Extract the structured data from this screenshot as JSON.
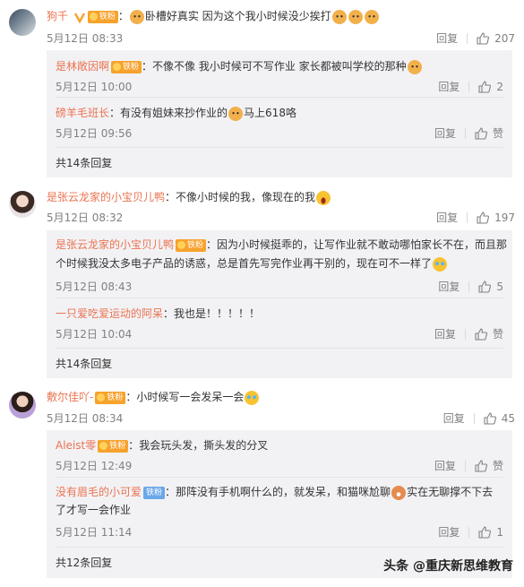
{
  "comments": [
    {
      "user": "狗千",
      "text": "卧槽好真实  因为这个我小时候没少挨打",
      "date": "5月12日 08:33",
      "reply_label": "回复",
      "likes": "207",
      "subreplies": [
        {
          "user": "是林敞因啊",
          "text": "不像不像 我小时候可不写作业 家长都被叫学校的那种",
          "date": "5月12日 10:00",
          "reply_label": "回复",
          "likes": "2"
        },
        {
          "user": "磅羊毛班长",
          "text": "有没有姐妹来抄作业的",
          "text2": "马上618咯",
          "date": "5月12日 09:56",
          "reply_label": "回复",
          "likes": "赞"
        }
      ],
      "more": "共14条回复"
    },
    {
      "user": "是张云龙家的小宝贝儿鸭",
      "text": "不像小时候的我，像现在的我",
      "date": "5月12日 08:32",
      "reply_label": "回复",
      "likes": "197",
      "subreplies": [
        {
          "user": "是张云龙家的小宝贝儿鸭",
          "text": "因为小时候挺乖的，让写作业就不敢动哪怕家长不在，而且那",
          "text_line2": "个时候我没太多电子产品的诱惑，总是首先写完作业再干别的，现在可不一样了",
          "date": "5月12日 08:43",
          "reply_label": "回复",
          "likes": "5"
        },
        {
          "user": "一只爱吃爱运动的阿呆",
          "text": "我也是！！！！！",
          "date": "5月12日 10:04",
          "reply_label": "回复",
          "likes": "赞"
        }
      ],
      "more": "共14条回复"
    },
    {
      "user": "敷尔佳吖-",
      "text": "小时候写一会发呆一会",
      "date": "5月12日 08:34",
      "reply_label": "回复",
      "likes": "45",
      "subreplies": [
        {
          "user": "Aleist零",
          "text": "我会玩头发，撕头发的分叉",
          "date": "5月12日 12:49",
          "reply_label": "回复",
          "likes": "赞"
        },
        {
          "user": "没有眉毛的小可爱",
          "text": "那阵没有手机啊什么的，就发呆，和猫咪尬聊",
          "text_tail": "实在无聊撑不下去",
          "text_line2": "了才写一会作业",
          "date": "5月12日 11:14",
          "reply_label": "回复",
          "likes": "1"
        }
      ],
      "more": "共12条回复"
    }
  ],
  "badge_fan_label": "铁粉",
  "watermark": "头条 @重庆新思维教育",
  "colors": {
    "username": "#eb7350",
    "reply_bg": "#f2f2f5",
    "meta": "#808080"
  }
}
